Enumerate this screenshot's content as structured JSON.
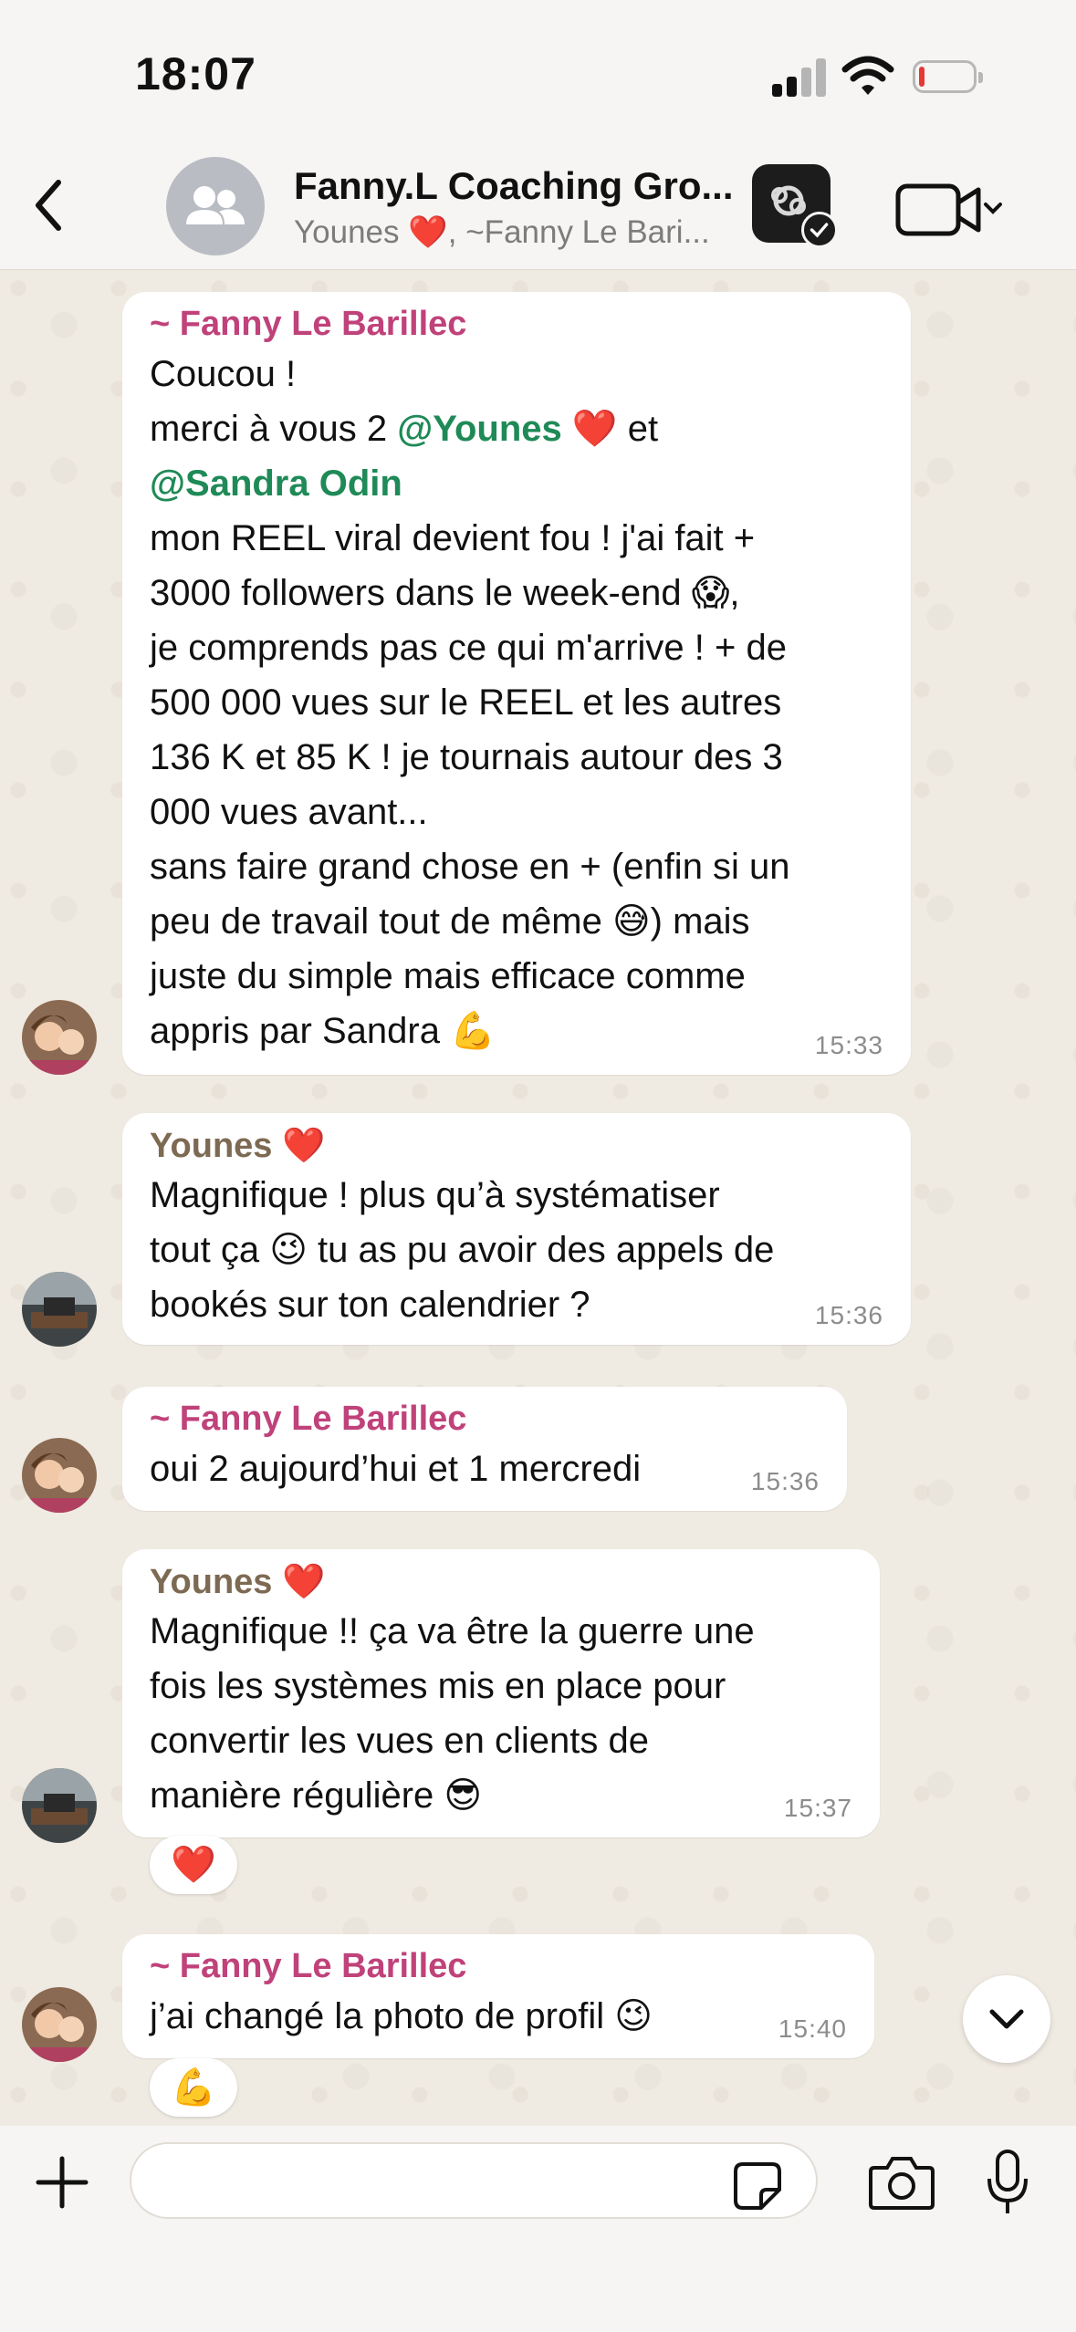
{
  "status_bar": {
    "time": "18:07",
    "battery_level": 0.1,
    "battery_color": "#e53935"
  },
  "header": {
    "title": "Fanny.L Coaching Gro...",
    "subtitle": "Younes ❤️, ~Fanny Le Bari...",
    "icons": [
      "back-arrow-icon",
      "group-avatar-icon",
      "app-shortcut-icon",
      "video-call-icon",
      "chevron-down-icon"
    ]
  },
  "colors": {
    "fanny_name": "#c0427a",
    "younes_name": "#7d6a52",
    "mention": "#1f8a57",
    "bubble": "#ffffff",
    "chat_bg": "#efeae2"
  },
  "messages": [
    {
      "sender": "~ Fanny Le Barillec",
      "lines": [
        "Coucou !",
        {
          "pre": "merci à vous 2 ",
          "at": "@",
          "mention": "Younes",
          "post": " ❤️  et"
        },
        {
          "pre": "",
          "at": "@",
          "mention": "Sandra Odin",
          "post": ""
        },
        "mon REEL viral devient fou ! j'ai fait +",
        "3000 followers dans le week-end 😱,",
        "je comprends pas ce qui m'arrive ! + de",
        "500 000 vues sur le REEL et les autres",
        "136 K et 85 K ! je tournais autour des 3",
        "000 vues avant...",
        "sans faire grand chose en + (enfin si un",
        "peu de travail tout de même 😅) mais",
        "juste du simple mais efficace comme",
        "appris par Sandra 💪"
      ],
      "time": "15:33"
    },
    {
      "sender": "Younes ❤️",
      "lines": [
        "Magnifique ! plus qu’à systématiser",
        "tout ça 😉 tu as pu avoir des appels de",
        "bookés sur ton calendrier ?"
      ],
      "time": "15:36"
    },
    {
      "sender": "~ Fanny Le Barillec",
      "lines": [
        "oui 2 aujourd’hui et 1 mercredi"
      ],
      "time": "15:36"
    },
    {
      "sender": "Younes ❤️",
      "lines": [
        "Magnifique !! ça va être la guerre une",
        "fois les systèmes mis en place pour",
        "convertir les vues en clients de",
        "manière régulière 😎"
      ],
      "time": "15:37",
      "reaction": "❤️"
    },
    {
      "sender": "~ Fanny Le Barillec",
      "lines": [
        "j’ai changé la photo de profil 😉"
      ],
      "time": "15:40",
      "reaction": "💪"
    }
  ],
  "input_bar": {
    "text": "",
    "icons": [
      "plus-icon",
      "sticker-icon",
      "camera-icon",
      "microphone-icon"
    ]
  }
}
